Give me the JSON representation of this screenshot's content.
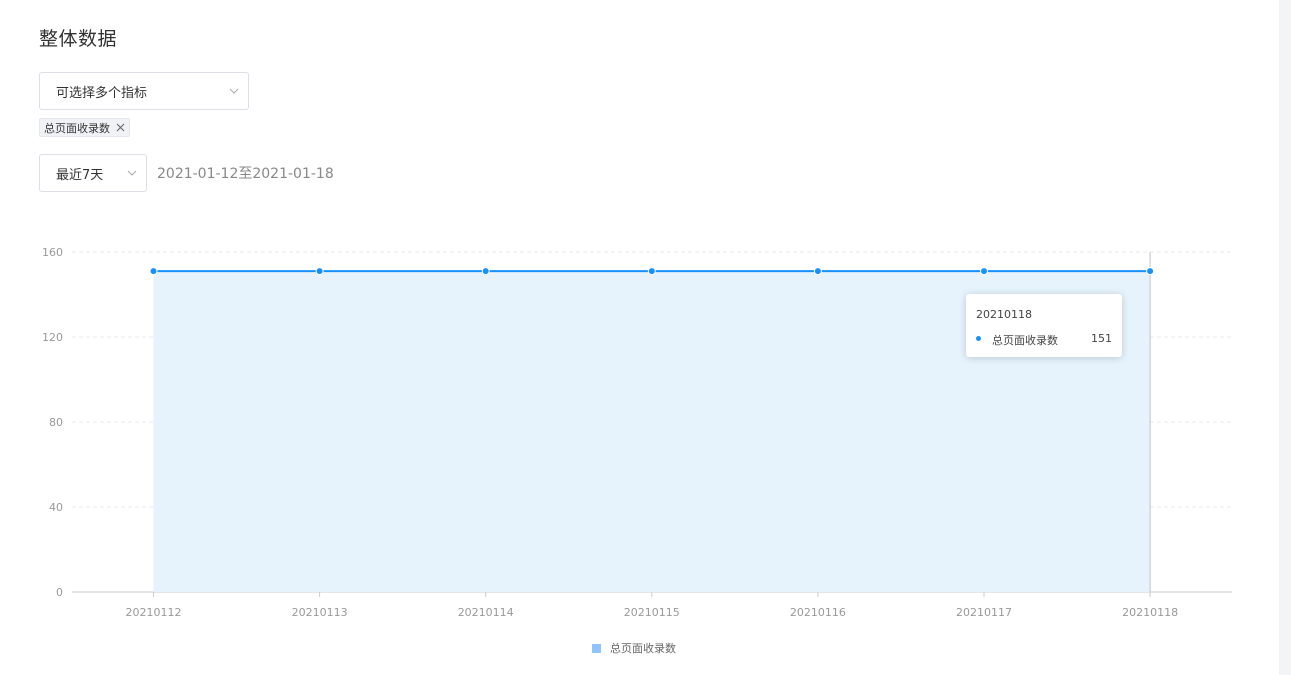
{
  "page": {
    "title": "整体数据"
  },
  "metric_select": {
    "placeholder": "可选择多个指标",
    "selected_tags": [
      "总页面收录数"
    ]
  },
  "time_range": {
    "selected": "最近7天",
    "date_text": "2021-01-12至2021-01-18"
  },
  "colors": {
    "line": "#1890ff",
    "area": "#e6f3fd",
    "legend_swatch": "#8ec5ff"
  },
  "icons": {
    "select_arrow": "chevron-down-icon",
    "tag_remove": "close-icon"
  },
  "chart_data": {
    "type": "area",
    "x": [
      "20210112",
      "20210113",
      "20210114",
      "20210115",
      "20210116",
      "20210117",
      "20210118"
    ],
    "series": [
      {
        "name": "总页面收录数",
        "values": [
          151,
          151,
          151,
          151,
          151,
          151,
          151
        ]
      }
    ],
    "ylim": [
      0,
      160
    ],
    "yticks": [
      "0",
      "40",
      "80",
      "120",
      "160"
    ],
    "grid": true,
    "legend": "bottom-center",
    "tooltip": {
      "title": "20210118",
      "name": "总页面收录数",
      "value": "151"
    }
  }
}
